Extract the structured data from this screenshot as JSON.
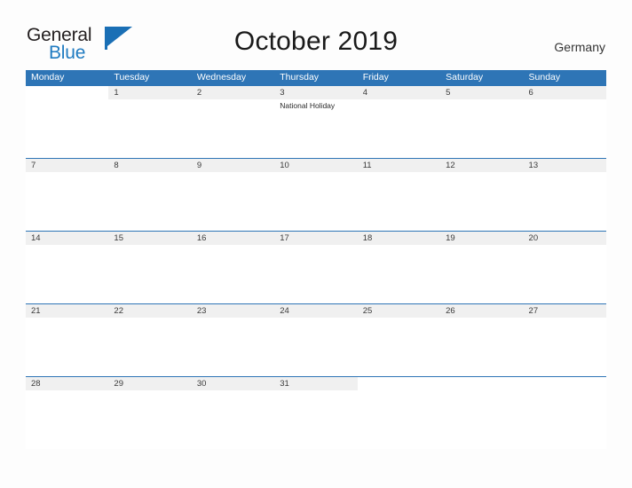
{
  "brand": {
    "name_part1": "General",
    "name_part2": "Blue",
    "accent_color": "#1a6fb5"
  },
  "header": {
    "title": "October 2019",
    "country": "Germany"
  },
  "calendar": {
    "header_bg": "#2e75b6",
    "band_bg": "#f0f0f0",
    "weekdays": [
      "Monday",
      "Tuesday",
      "Wednesday",
      "Thursday",
      "Friday",
      "Saturday",
      "Sunday"
    ],
    "weeks": [
      {
        "days": [
          {
            "num": "",
            "events": []
          },
          {
            "num": "1",
            "events": []
          },
          {
            "num": "2",
            "events": []
          },
          {
            "num": "3",
            "events": [
              "National Holiday"
            ]
          },
          {
            "num": "4",
            "events": []
          },
          {
            "num": "5",
            "events": []
          },
          {
            "num": "6",
            "events": []
          }
        ]
      },
      {
        "days": [
          {
            "num": "7",
            "events": []
          },
          {
            "num": "8",
            "events": []
          },
          {
            "num": "9",
            "events": []
          },
          {
            "num": "10",
            "events": []
          },
          {
            "num": "11",
            "events": []
          },
          {
            "num": "12",
            "events": []
          },
          {
            "num": "13",
            "events": []
          }
        ]
      },
      {
        "days": [
          {
            "num": "14",
            "events": []
          },
          {
            "num": "15",
            "events": []
          },
          {
            "num": "16",
            "events": []
          },
          {
            "num": "17",
            "events": []
          },
          {
            "num": "18",
            "events": []
          },
          {
            "num": "19",
            "events": []
          },
          {
            "num": "20",
            "events": []
          }
        ]
      },
      {
        "days": [
          {
            "num": "21",
            "events": []
          },
          {
            "num": "22",
            "events": []
          },
          {
            "num": "23",
            "events": []
          },
          {
            "num": "24",
            "events": []
          },
          {
            "num": "25",
            "events": []
          },
          {
            "num": "26",
            "events": []
          },
          {
            "num": "27",
            "events": []
          }
        ]
      },
      {
        "days": [
          {
            "num": "28",
            "events": []
          },
          {
            "num": "29",
            "events": []
          },
          {
            "num": "30",
            "events": []
          },
          {
            "num": "31",
            "events": []
          },
          {
            "num": "",
            "events": []
          },
          {
            "num": "",
            "events": []
          },
          {
            "num": "",
            "events": []
          }
        ]
      }
    ]
  }
}
